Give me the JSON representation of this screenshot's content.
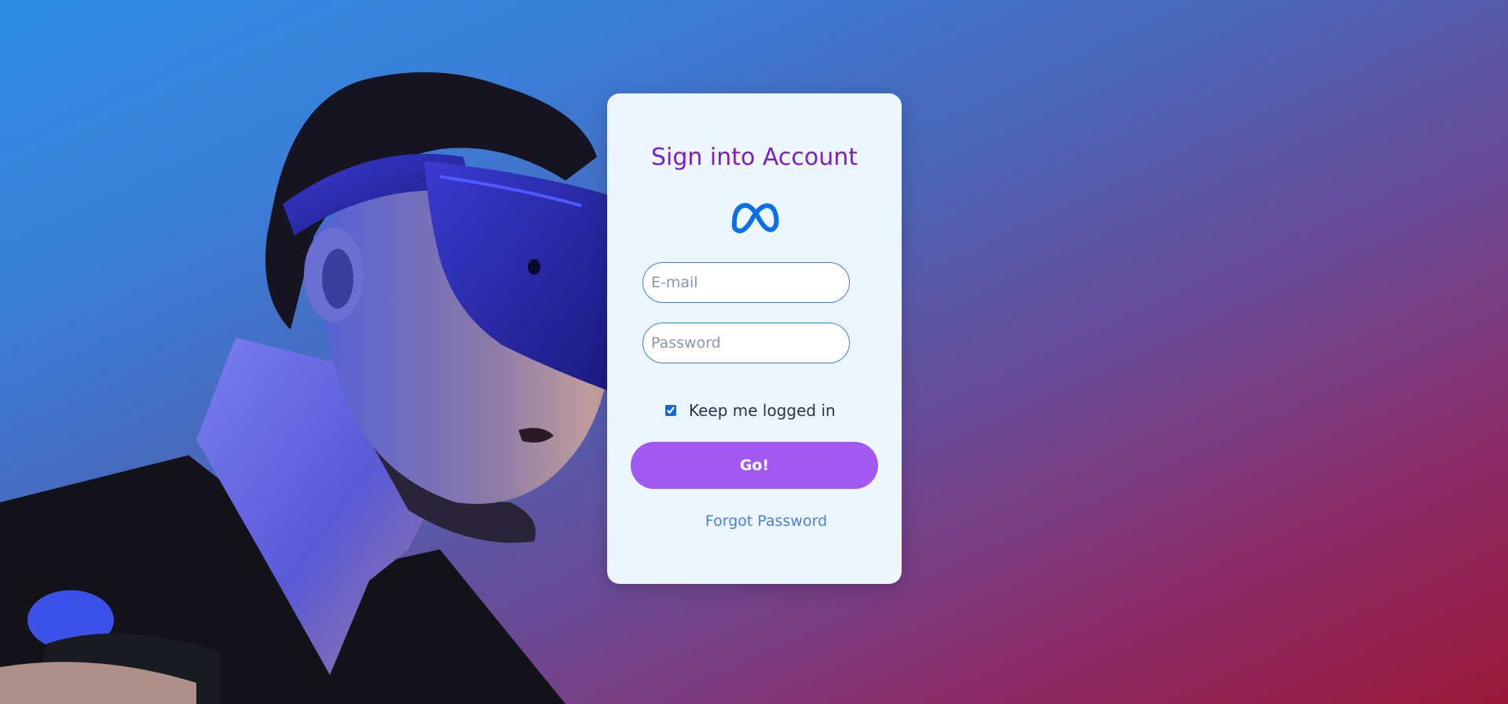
{
  "login": {
    "title": "Sign into Account",
    "logo_icon": "meta-infinity-logo-icon",
    "email_placeholder": "E-mail",
    "email_value": "",
    "password_placeholder": "Password",
    "password_value": "",
    "remember_label": "Keep me logged in",
    "remember_checked": true,
    "submit_label": "Go!",
    "forgot_label": "Forgot Password"
  },
  "colors": {
    "title": "#7e1fc4",
    "button": "#a259f2",
    "link": "#4a83d4",
    "card_background": "#eef6fd",
    "input_border": "#3b82d6",
    "logo": "#0a6fe8"
  },
  "hero": {
    "icon": "vr-headset-person-illustration"
  }
}
